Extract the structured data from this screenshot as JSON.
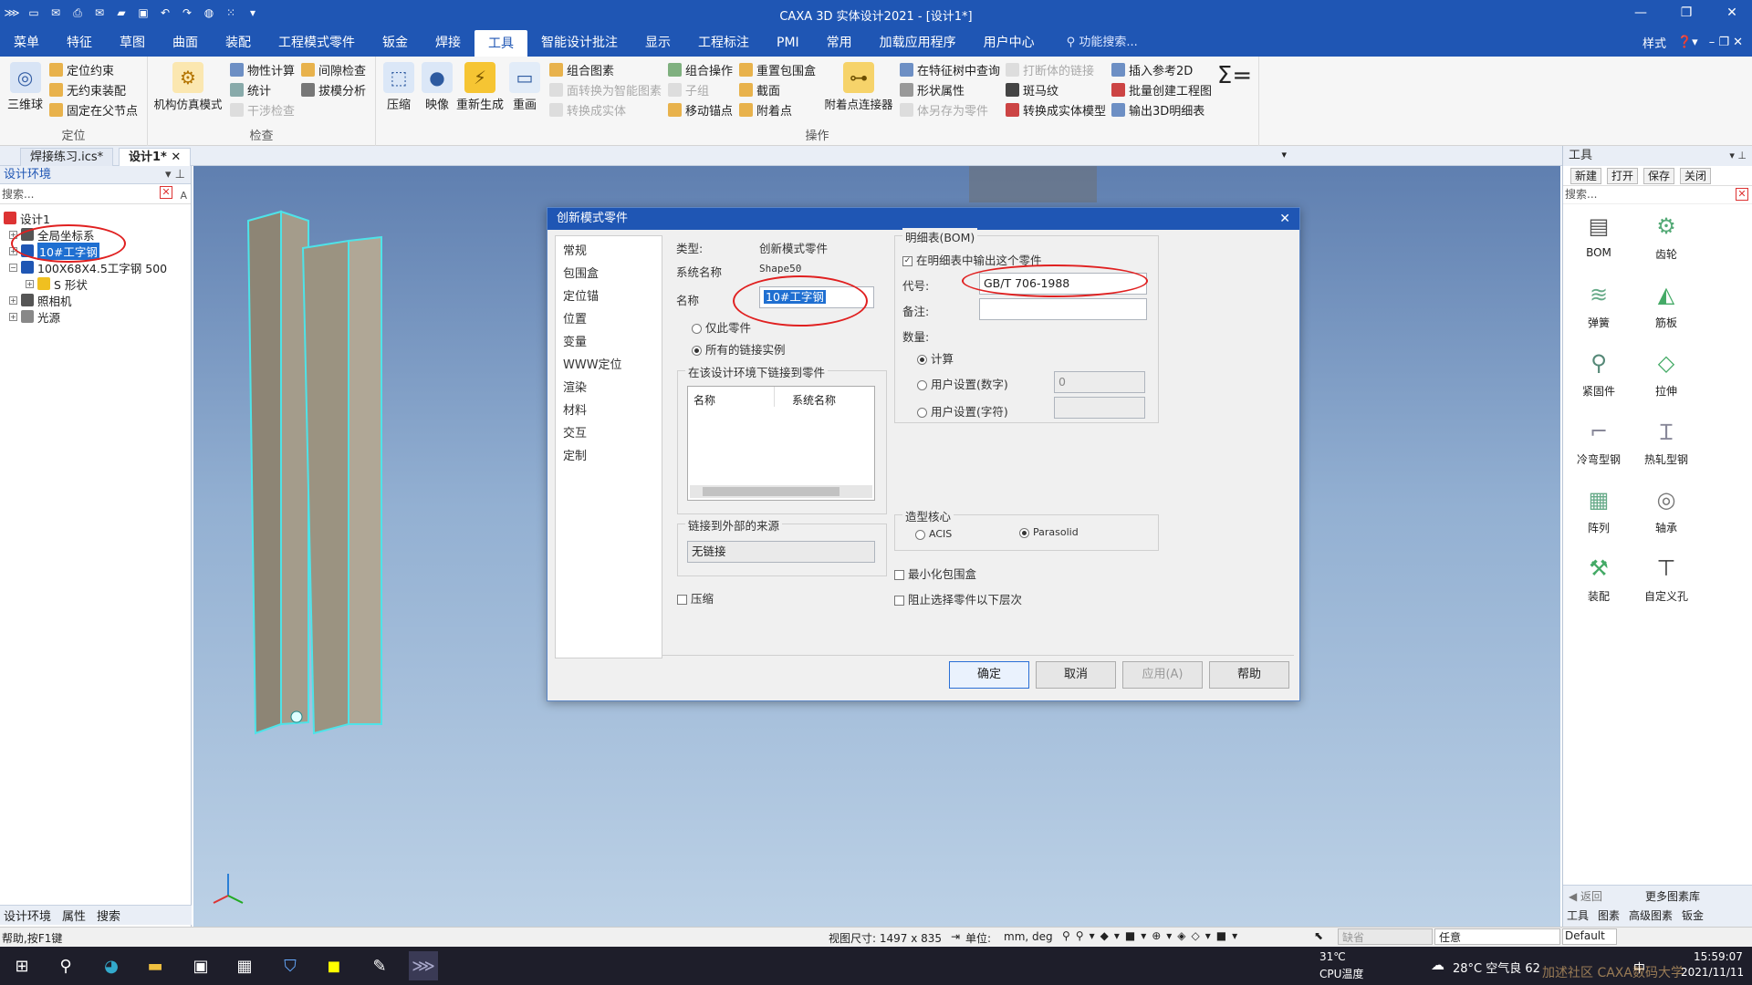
{
  "window": {
    "title": "CAXA 3D 实体设计2021 - [设计1*]",
    "controls": [
      "—",
      "❐",
      "✕"
    ]
  },
  "menubar": {
    "tabs": [
      "菜单",
      "特征",
      "草图",
      "曲面",
      "装配",
      "工程模式零件",
      "钣金",
      "焊接",
      "工具",
      "智能设计批注",
      "显示",
      "工程标注",
      "PMI",
      "常用",
      "加载应用程序",
      "用户中心"
    ],
    "search_placeholder": "功能搜索...",
    "style_label": "样式"
  },
  "ribbon": {
    "locate": {
      "label": "定位",
      "big": "三维球",
      "items": [
        "定位约束",
        "无约束装配",
        "固定在父节点"
      ]
    },
    "check": {
      "label": "检查",
      "big": "机构仿真模式",
      "items": [
        "物性计算",
        "统计",
        "干涉检查",
        "间隙检查",
        "拔模分析"
      ]
    },
    "ops": {
      "label": "操作",
      "big": [
        "压缩",
        "映像",
        "重新生成",
        "重画"
      ],
      "col1": [
        "组合图素",
        "面转换为智能图素",
        "转换成实体"
      ],
      "col2": [
        "组合操作",
        "子组",
        "移动锚点"
      ],
      "col3": [
        "重置包围盒",
        "截面",
        "附着点"
      ],
      "attach": "附着点连接器",
      "col4": [
        "在特征树中查询",
        "形状属性",
        "体另存为零件"
      ],
      "col5": [
        "打断体的链接",
        "斑马纹",
        "转换成实体模型"
      ],
      "col6": [
        "插入参考2D",
        "批量创建工程图",
        "输出3D明细表"
      ]
    }
  },
  "doc_tabs": [
    "焊接练习.ics*",
    "设计1*"
  ],
  "left_panel": {
    "title": "设计环境",
    "search": "搜索...",
    "tree": [
      "设计1",
      "全局坐标系",
      "10#工字钢",
      "100X68X4.5工字钢 500",
      "S 形状",
      "照相机",
      "光源"
    ],
    "bottom_tabs": [
      "设计环境",
      "属性",
      "搜索"
    ]
  },
  "dialog": {
    "title": "创新模式零件",
    "nav": [
      "常规",
      "包围盒",
      "定位锚",
      "位置",
      "变量",
      "WWW定位",
      "渲染",
      "材料",
      "交互",
      "定制"
    ],
    "type_label": "类型:",
    "type_value": "创新模式零件",
    "sysname_label": "系统名称",
    "sysname_value": "Shape50",
    "name_label": "名称",
    "name_value": "10#工字钢",
    "radio_only": "仅此零件",
    "radio_all": "所有的链接实例",
    "linked_group": "在该设计环境下链接到零件",
    "col_name": "名称",
    "col_sysname": "系统名称",
    "external_group": "链接到外部的来源",
    "external_value": "无链接",
    "compress": "压缩",
    "bom_group": "明细表(BOM)",
    "bom_output": "在明细表中输出这个零件",
    "code_label": "代号:",
    "code_value": "GB/T 706-1988",
    "remark_label": "备注:",
    "qty_label": "数量:",
    "qty_calc": "计算",
    "qty_user_num": "用户设置(数字)",
    "qty_user_num_value": "0",
    "qty_user_str": "用户设置(字符)",
    "kernel_group": "造型核心",
    "kernel_acis": "ACIS",
    "kernel_parasolid": "Parasolid",
    "min_box": "最小化包围盒",
    "block_select": "阻止选择零件以下层次",
    "buttons": [
      "确定",
      "取消",
      "应用(A)",
      "帮助"
    ]
  },
  "right_panel": {
    "title": "工具",
    "buttons": [
      "新建",
      "打开",
      "保存",
      "关闭"
    ],
    "search": "搜索...",
    "tools": [
      "BOM",
      "齿轮",
      "弹簧",
      "筋板",
      "紧固件",
      "拉伸",
      "冷弯型钢",
      "热轧型钢",
      "阵列",
      "轴承",
      "装配",
      "自定义孔"
    ],
    "foot_back": "返回",
    "foot_more": "更多图素库",
    "foot_tabs": [
      "工具",
      "图素",
      "高级图素",
      "钣金"
    ]
  },
  "statusbar": {
    "help": "帮助,按F1键",
    "view_size": "视图尺寸: 1497 x  835",
    "unit_label": "单位:",
    "unit_value": "mm, deg",
    "filter": "缺省",
    "any": "任意",
    "default": "Default"
  },
  "taskbar": {
    "temp": "31℃",
    "temp_label": "CPU温度",
    "weather": "28°C  空气良 62",
    "time": "15:59:07",
    "date": "2021/11/11",
    "ime": "中",
    "watermark": "加述社区  CAXA数码大学"
  },
  "colors": {
    "accent": "#1f56b4",
    "annotation": "#e02020"
  }
}
